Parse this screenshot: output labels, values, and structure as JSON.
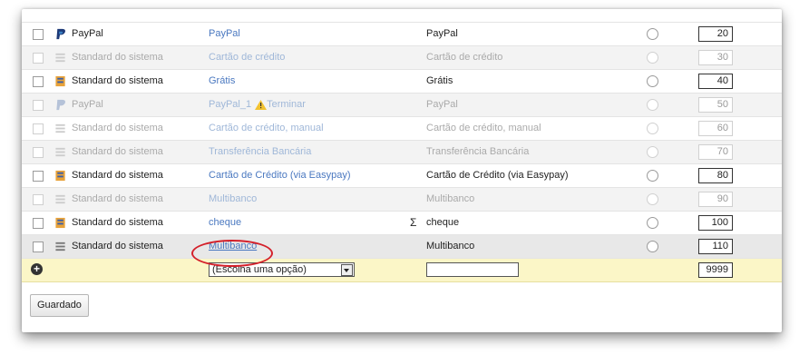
{
  "rows": [
    {
      "provider": "PayPal",
      "link": "PayPal",
      "name": "PayPal",
      "order": "20",
      "dim": false,
      "icon": "paypal-icon"
    },
    {
      "provider": "Standard do sistema",
      "link": "Cartão de crédito",
      "name": "Cartão de crédito",
      "order": "30",
      "dim": true,
      "icon": "system-icon"
    },
    {
      "provider": "Standard do sistema",
      "link": "Grátis",
      "name": "Grátis",
      "order": "40",
      "dim": false,
      "icon": "system-icon"
    },
    {
      "provider": "PayPal",
      "link": "PayPal_1",
      "warning": "Terminar",
      "name": "PayPal",
      "order": "50",
      "dim": true,
      "icon": "paypal-icon"
    },
    {
      "provider": "Standard do sistema",
      "link": "Cartão de crédito, manual",
      "name": "Cartão de crédito, manual",
      "order": "60",
      "dim": true,
      "icon": "system-icon"
    },
    {
      "provider": "Standard do sistema",
      "link": "Transferência Bancária",
      "name": "Transferência Bancária",
      "order": "70",
      "dim": true,
      "icon": "system-icon"
    },
    {
      "provider": "Standard do sistema",
      "link": "Cartão de Crédito (via Easypay)",
      "name": "Cartão de Crédito (via Easypay)",
      "order": "80",
      "dim": false,
      "icon": "system-icon"
    },
    {
      "provider": "Standard do sistema",
      "link": "Multibanco",
      "name": "Multibanco",
      "order": "90",
      "dim": true,
      "icon": "system-icon"
    },
    {
      "provider": "Standard do sistema",
      "link": "cheque",
      "name": "cheque",
      "order": "100",
      "dim": false,
      "sigma": "Σ",
      "icon": "system-icon"
    },
    {
      "provider": "Standard do sistema",
      "link": "Multibanco",
      "name": "Multibanco",
      "order": "110",
      "dim": false,
      "icon": "system-icon",
      "highlighted": true
    }
  ],
  "add_row": {
    "select_value": "(Escolha uma opção)",
    "name_value": "",
    "order": "9999"
  },
  "save_button": "Guardado",
  "colors": {
    "link": "#4a78c0",
    "add_row_bg": "#fbf6c7",
    "highlight_circle": "#d4202a"
  }
}
